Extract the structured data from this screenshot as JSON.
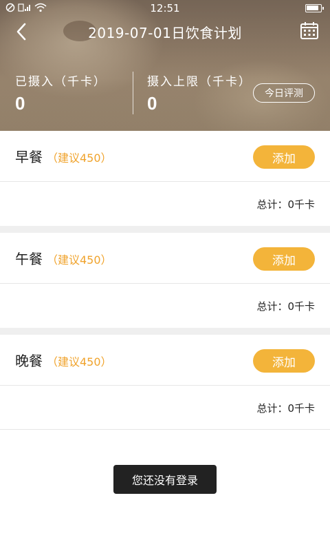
{
  "statusbar": {
    "time": "12:51",
    "icons": [
      "blocked-icon",
      "sim-signal-icon",
      "wifi-icon",
      "battery-icon"
    ]
  },
  "header": {
    "title": "2019-07-01日饮食计划",
    "back_icon": "chevron-left-icon",
    "calendar_icon": "calendar-icon",
    "consumed_label": "已摄入（千卡）",
    "consumed_value": "0",
    "limit_label": "摄入上限（千卡）",
    "limit_value": "0",
    "evaluate_label": "今日评测"
  },
  "meals": [
    {
      "name": "早餐",
      "suggest": "（建议450）",
      "add_label": "添加",
      "total": "总计：0千卡"
    },
    {
      "name": "午餐",
      "suggest": "（建议450）",
      "add_label": "添加",
      "total": "总计：0千卡"
    },
    {
      "name": "晚餐",
      "suggest": "（建议450）",
      "add_label": "添加",
      "total": "总计：0千卡"
    }
  ],
  "toast": {
    "text": "您还没有登录"
  },
  "colors": {
    "accent": "#f3b43a",
    "suggest_text": "#f0a32c",
    "toast_bg": "#222222"
  }
}
